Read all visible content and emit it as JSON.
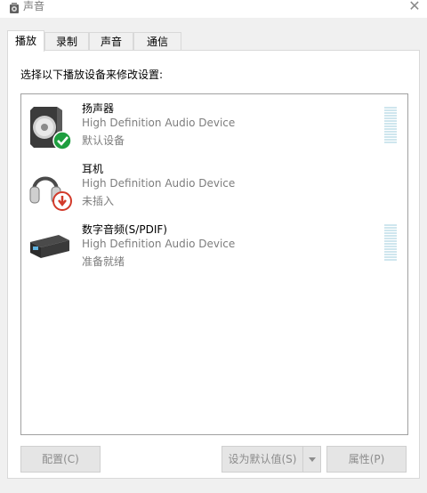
{
  "window": {
    "title": "声音",
    "title_icon": "speaker-icon",
    "close_glyph": "✕"
  },
  "tabs": [
    {
      "label": "播放",
      "active": true
    },
    {
      "label": "录制",
      "active": false
    },
    {
      "label": "声音",
      "active": false
    },
    {
      "label": "通信",
      "active": false
    }
  ],
  "playback": {
    "instruction": "选择以下播放设备来修改设置:",
    "devices": [
      {
        "name": "扬声器",
        "description": "High Definition Audio Device",
        "status": "默认设备",
        "icon": "speaker-device-icon",
        "badge": "default-check-icon"
      },
      {
        "name": "耳机",
        "description": "High Definition Audio Device",
        "status": "未插入",
        "icon": "headphones-icon",
        "badge": "unplugged-arrow-icon"
      },
      {
        "name": "数字音频(S/PDIF)",
        "description": "High Definition Audio Device",
        "status": "准备就绪",
        "icon": "digital-audio-box-icon"
      }
    ]
  },
  "buttons": {
    "configure": "配置(C)",
    "set_default": "设为默认值(S)",
    "properties": "属性(P)"
  },
  "colors": {
    "check_badge": "#1e9e3f",
    "unplugged_badge": "#d23a2a",
    "meter": "#cfe6ee"
  }
}
